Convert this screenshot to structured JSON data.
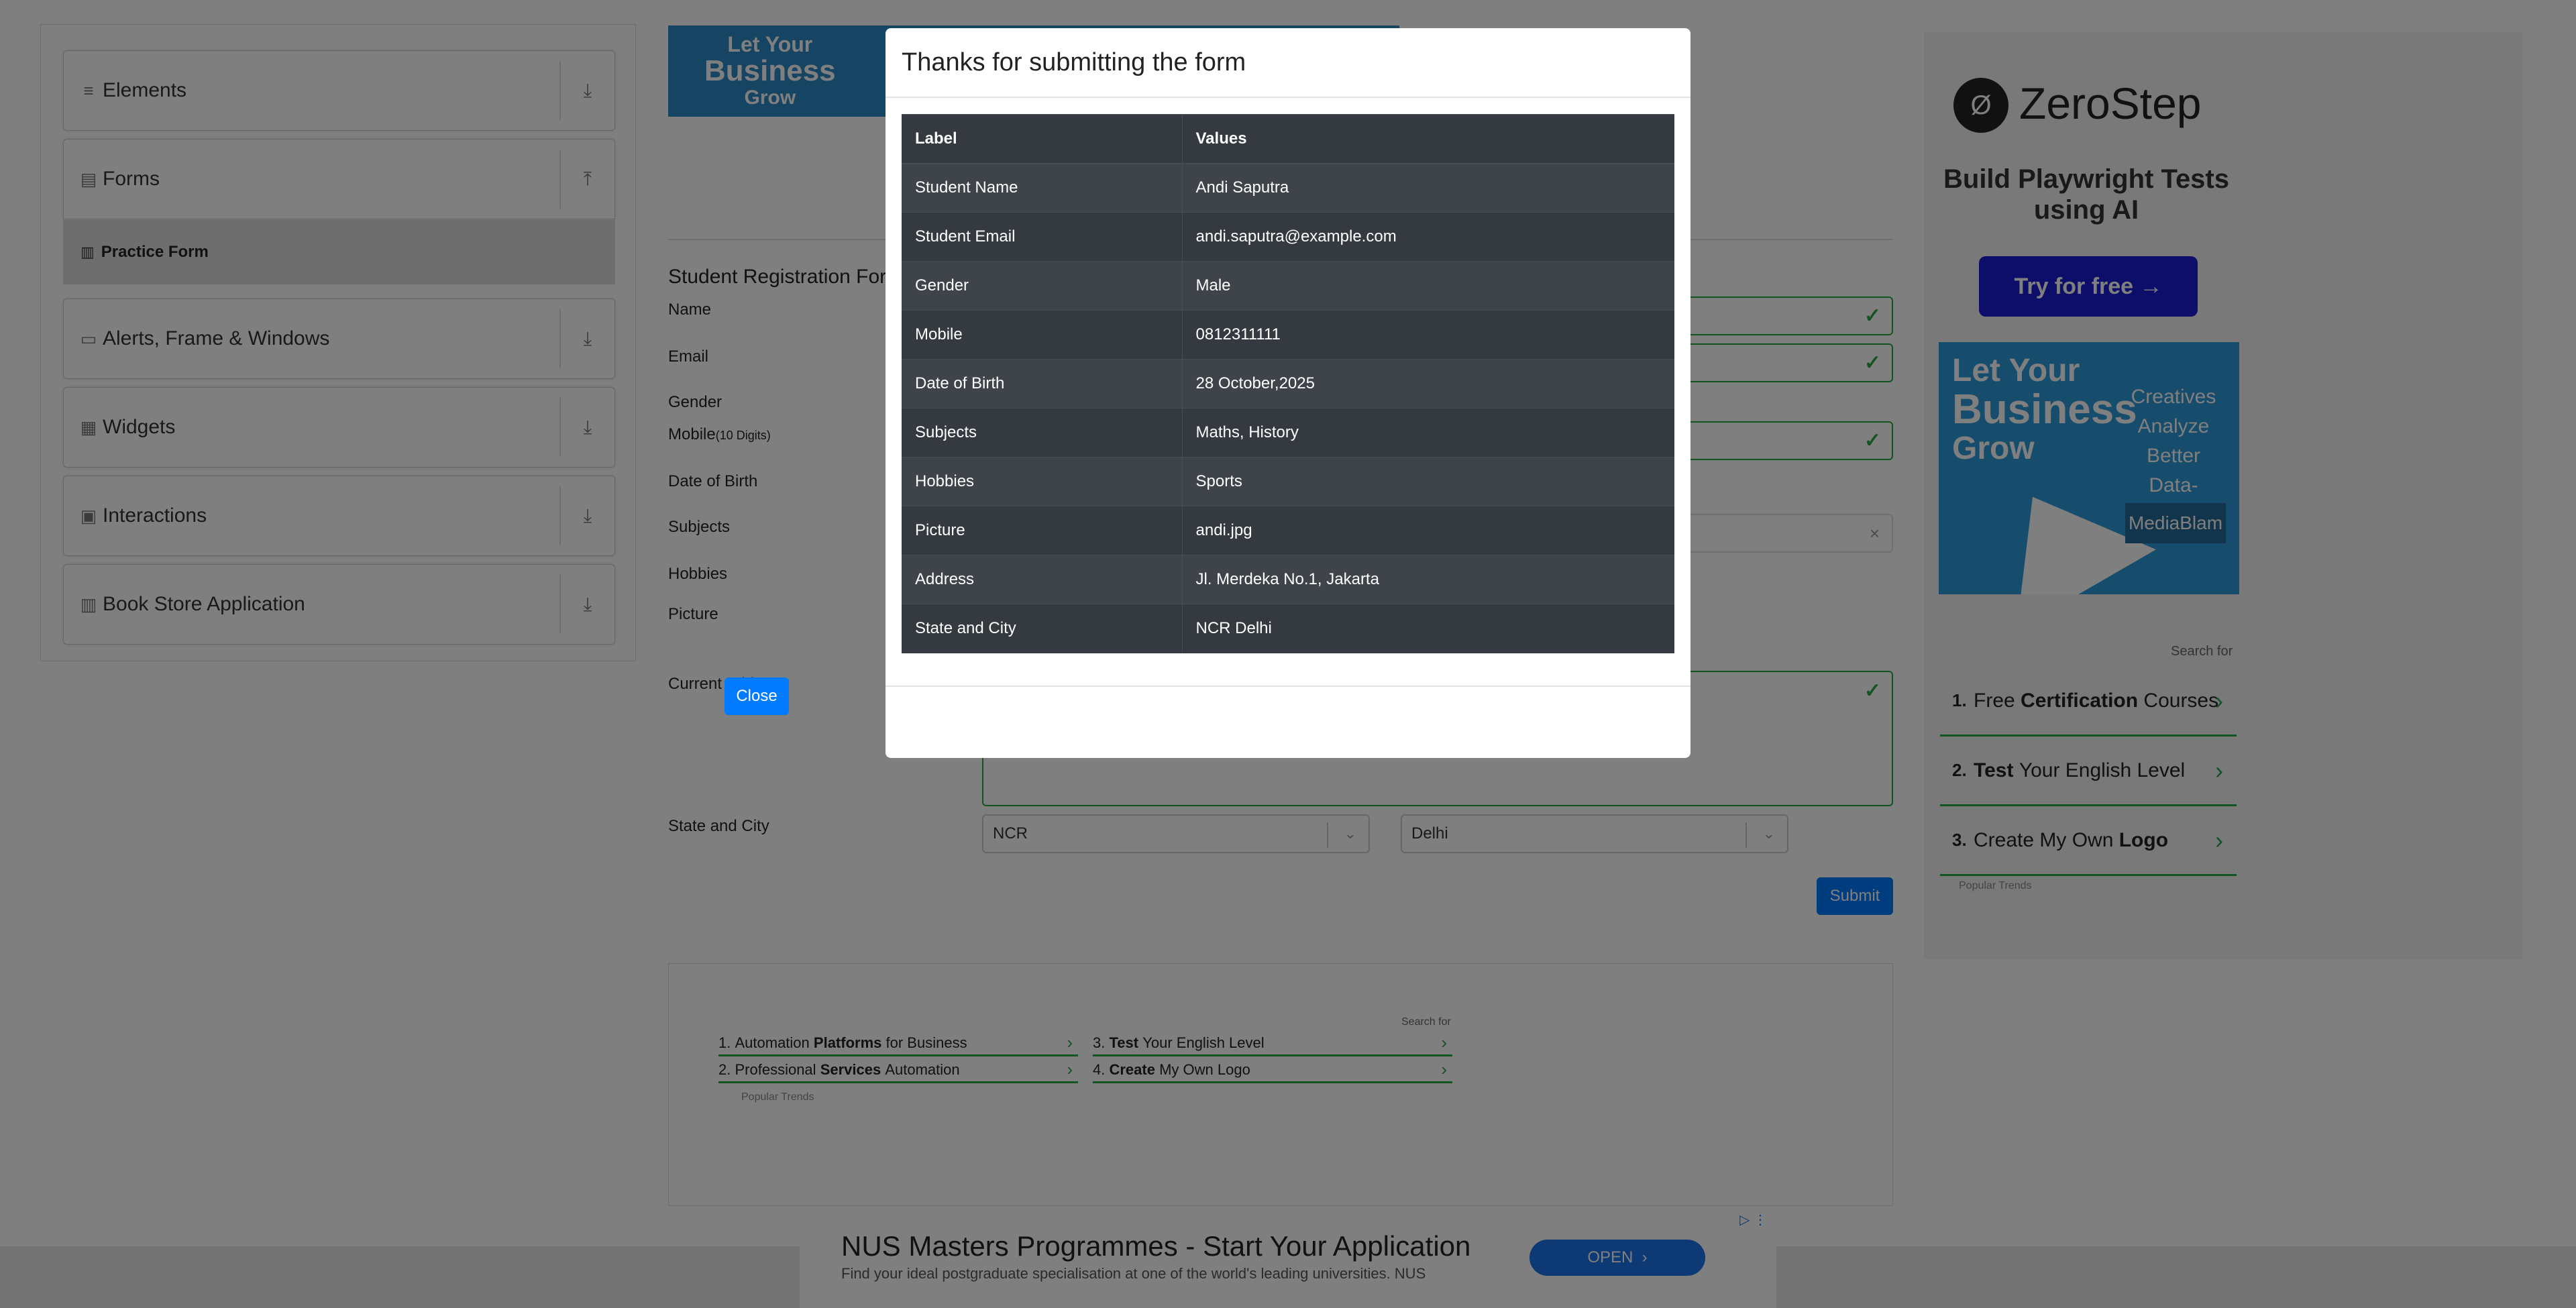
{
  "sidebar": {
    "groups": [
      {
        "label": "Elements",
        "icon": "hamburger-icon"
      },
      {
        "label": "Forms",
        "icon": "forms-icon"
      },
      {
        "label": "Alerts, Frame & Windows",
        "icon": "window-icon"
      },
      {
        "label": "Widgets",
        "icon": "widgets-icon"
      },
      {
        "label": "Interactions",
        "icon": "interactions-icon"
      },
      {
        "label": "Book Store Application",
        "icon": "books-icon"
      }
    ],
    "active_item": "Practice Form"
  },
  "form": {
    "title": "Student Registration For",
    "labels": {
      "name": "Name",
      "email": "Email",
      "gender": "Gender",
      "mobile": "Mobile",
      "mobile_hint": "(10 Digits)",
      "dob": "Date of Birth",
      "subjects": "Subjects",
      "hobbies": "Hobbies",
      "picture": "Picture",
      "address": "Current Address",
      "state_city": "State and City"
    },
    "state": "NCR",
    "city": "Delhi",
    "submit": "Submit"
  },
  "ads": {
    "top_banner": {
      "line1": "Let Your",
      "line2": "Business",
      "line3": "Grow"
    },
    "zerostep": {
      "brand": "ZeroStep",
      "tagline": "Build Playwright Tests using AI",
      "cta": "Try for free →"
    },
    "mediablam": {
      "line1": "Let Your",
      "line2": "Business",
      "line3": "Grow",
      "side": "Creatives Analyze Better Data-Driven",
      "brand": "MediaBlam"
    },
    "search_for": "Search for",
    "right_list": [
      {
        "n": "1.",
        "pre": "Free ",
        "b": "Certification",
        "post": " Courses"
      },
      {
        "n": "2.",
        "pre": "",
        "b": "Test",
        "post": " Your English Level"
      },
      {
        "n": "3.",
        "pre": "Create My Own ",
        "b": "Logo",
        "post": ""
      }
    ],
    "popular": "Popular Trends",
    "bottom_list": [
      {
        "n": "1.",
        "pre": "Automation ",
        "b": "Platforms",
        "post": " for Business"
      },
      {
        "n": "2.",
        "pre": "Professional ",
        "b": "Services",
        "post": " Automation"
      },
      {
        "n": "3.",
        "pre": "",
        "b": "Test",
        "post": " Your English Level"
      },
      {
        "n": "4.",
        "pre": "",
        "b": "Create",
        "post": " My Own Logo"
      }
    ],
    "nus": {
      "headline": "NUS Masters Programmes - Start Your Application",
      "sub": "Find your ideal postgraduate specialisation at one of the world's leading universities. NUS",
      "cta": "OPEN"
    }
  },
  "modal": {
    "title": "Thanks for submitting the form",
    "headers": [
      "Label",
      "Values"
    ],
    "rows": [
      [
        "Student Name",
        "Andi Saputra"
      ],
      [
        "Student Email",
        "andi.saputra@example.com"
      ],
      [
        "Gender",
        "Male"
      ],
      [
        "Mobile",
        "0812311111"
      ],
      [
        "Date of Birth",
        "28 October,2025"
      ],
      [
        "Subjects",
        "Maths, History"
      ],
      [
        "Hobbies",
        "Sports"
      ],
      [
        "Picture",
        "andi.jpg"
      ],
      [
        "Address",
        "Jl. Merdeka No.1, Jakarta"
      ],
      [
        "State and City",
        "NCR Delhi"
      ]
    ],
    "close": "Close"
  }
}
